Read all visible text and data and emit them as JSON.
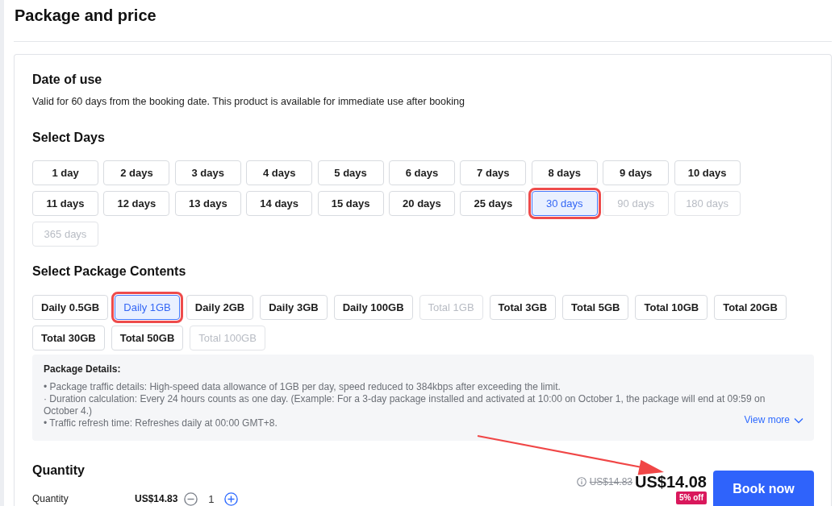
{
  "page": {
    "title": "Package and price"
  },
  "date_of_use": {
    "heading": "Date of use",
    "text": "Valid for 60 days from the booking date. This product is available for immediate use after booking"
  },
  "select_days": {
    "heading": "Select Days",
    "options": [
      {
        "label": "1 day",
        "selected": false,
        "disabled": false,
        "highlighted": false
      },
      {
        "label": "2 days",
        "selected": false,
        "disabled": false,
        "highlighted": false
      },
      {
        "label": "3 days",
        "selected": false,
        "disabled": false,
        "highlighted": false
      },
      {
        "label": "4 days",
        "selected": false,
        "disabled": false,
        "highlighted": false
      },
      {
        "label": "5 days",
        "selected": false,
        "disabled": false,
        "highlighted": false
      },
      {
        "label": "6 days",
        "selected": false,
        "disabled": false,
        "highlighted": false
      },
      {
        "label": "7 days",
        "selected": false,
        "disabled": false,
        "highlighted": false
      },
      {
        "label": "8 days",
        "selected": false,
        "disabled": false,
        "highlighted": false
      },
      {
        "label": "9 days",
        "selected": false,
        "disabled": false,
        "highlighted": false
      },
      {
        "label": "10 days",
        "selected": false,
        "disabled": false,
        "highlighted": false
      },
      {
        "label": "11 days",
        "selected": false,
        "disabled": false,
        "highlighted": false
      },
      {
        "label": "12 days",
        "selected": false,
        "disabled": false,
        "highlighted": false
      },
      {
        "label": "13 days",
        "selected": false,
        "disabled": false,
        "highlighted": false
      },
      {
        "label": "14 days",
        "selected": false,
        "disabled": false,
        "highlighted": false
      },
      {
        "label": "15 days",
        "selected": false,
        "disabled": false,
        "highlighted": false
      },
      {
        "label": "20 days",
        "selected": false,
        "disabled": false,
        "highlighted": false
      },
      {
        "label": "25 days",
        "selected": false,
        "disabled": false,
        "highlighted": false
      },
      {
        "label": "30 days",
        "selected": true,
        "disabled": false,
        "highlighted": true
      },
      {
        "label": "90 days",
        "selected": false,
        "disabled": true,
        "highlighted": false
      },
      {
        "label": "180 days",
        "selected": false,
        "disabled": true,
        "highlighted": false
      },
      {
        "label": "365 days",
        "selected": false,
        "disabled": true,
        "highlighted": false
      }
    ]
  },
  "package_contents": {
    "heading": "Select Package Contents",
    "options": [
      {
        "label": "Daily 0.5GB",
        "selected": false,
        "disabled": false,
        "highlighted": false
      },
      {
        "label": "Daily 1GB",
        "selected": true,
        "disabled": false,
        "highlighted": true
      },
      {
        "label": "Daily 2GB",
        "selected": false,
        "disabled": false,
        "highlighted": false
      },
      {
        "label": "Daily 3GB",
        "selected": false,
        "disabled": false,
        "highlighted": false
      },
      {
        "label": "Daily 100GB",
        "selected": false,
        "disabled": false,
        "highlighted": false
      },
      {
        "label": "Total 1GB",
        "selected": false,
        "disabled": true,
        "highlighted": false
      },
      {
        "label": "Total 3GB",
        "selected": false,
        "disabled": false,
        "highlighted": false
      },
      {
        "label": "Total 5GB",
        "selected": false,
        "disabled": false,
        "highlighted": false
      },
      {
        "label": "Total 10GB",
        "selected": false,
        "disabled": false,
        "highlighted": false
      },
      {
        "label": "Total 20GB",
        "selected": false,
        "disabled": false,
        "highlighted": false
      },
      {
        "label": "Total 30GB",
        "selected": false,
        "disabled": false,
        "highlighted": false
      },
      {
        "label": "Total 50GB",
        "selected": false,
        "disabled": false,
        "highlighted": false
      },
      {
        "label": "Total 100GB",
        "selected": false,
        "disabled": true,
        "highlighted": false
      }
    ]
  },
  "package_details": {
    "heading": "Package Details:",
    "lines": [
      "• Package traffic details: High-speed data allowance of 1GB per day, speed reduced to 384kbps after exceeding the limit.",
      "· Duration calculation: Every 24 hours counts as one day. (Example: For a 3-day package installed and activated at 10:00 on October 1, the package will end at 09:59 on October 4.)",
      "• Traffic refresh time: Refreshes daily at 00:00 GMT+8."
    ],
    "view_more": "View more"
  },
  "quantity": {
    "heading": "Quantity",
    "label": "Quantity",
    "unit_price": "US$14.83",
    "value": "1",
    "decrease_disabled": true
  },
  "price": {
    "original": "US$14.83",
    "current": "US$14.08",
    "discount": "5% off",
    "pointer_arrow": true
  },
  "book_button": "Book now"
}
